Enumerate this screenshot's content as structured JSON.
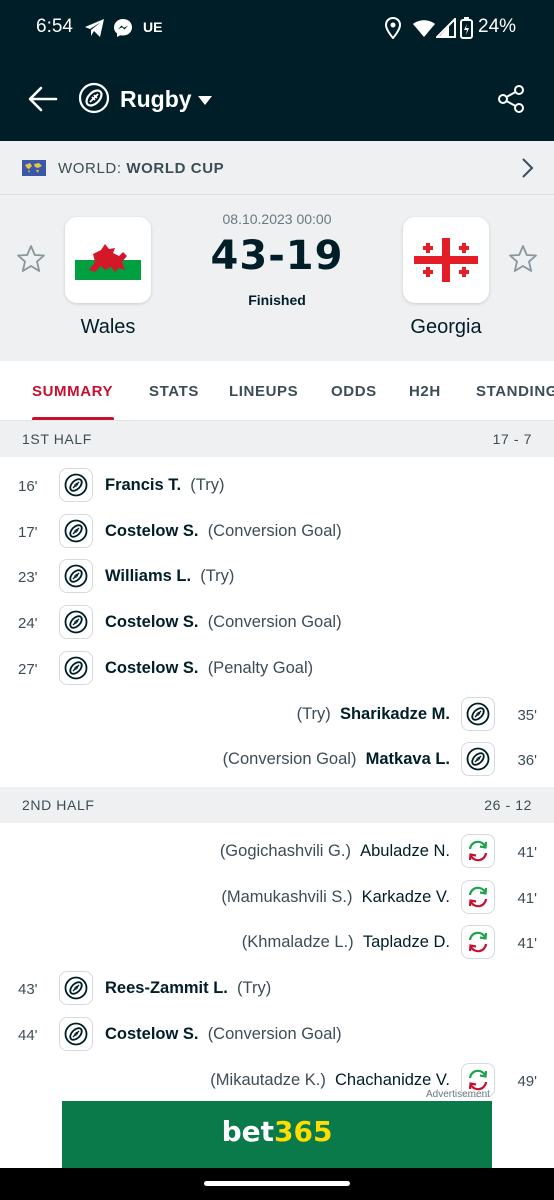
{
  "status_bar": {
    "time": "6:54",
    "carrier_badge": "UE",
    "battery": "24%"
  },
  "app_bar": {
    "sport": "Rugby",
    "icons": [
      "back-arrow-icon",
      "rugby-ball-icon",
      "dropdown-caret-icon",
      "share-icon"
    ]
  },
  "competition": {
    "region": "WORLD: ",
    "name": "WORLD CUP"
  },
  "match": {
    "date": "08.10.2023 00:00",
    "score": "43-19",
    "status": "Finished",
    "home": {
      "name": "Wales"
    },
    "away": {
      "name": "Georgia"
    }
  },
  "tabs": [
    "SUMMARY",
    "STATS",
    "LINEUPS",
    "ODDS",
    "H2H",
    "STANDINGS"
  ],
  "first_half": {
    "title": "1ST HALF",
    "score": "17 - 7",
    "events": [
      {
        "side": "home",
        "minute": "16'",
        "player": "Francis T.",
        "detail": "(Try)",
        "icon": "rugby-ball-icon"
      },
      {
        "side": "home",
        "minute": "17'",
        "player": "Costelow S.",
        "detail": "(Conversion Goal)",
        "icon": "rugby-ball-icon"
      },
      {
        "side": "home",
        "minute": "23'",
        "player": "Williams L.",
        "detail": "(Try)",
        "icon": "rugby-ball-icon"
      },
      {
        "side": "home",
        "minute": "24'",
        "player": "Costelow S.",
        "detail": "(Conversion Goal)",
        "icon": "rugby-ball-icon"
      },
      {
        "side": "home",
        "minute": "27'",
        "player": "Costelow S.",
        "detail": "(Penalty Goal)",
        "icon": "rugby-ball-icon"
      },
      {
        "side": "away",
        "minute": "35'",
        "player": "Sharikadze M.",
        "detail": "(Try)",
        "icon": "rugby-ball-icon"
      },
      {
        "side": "away",
        "minute": "36'",
        "player": "Matkava L.",
        "detail": "(Conversion Goal)",
        "icon": "rugby-ball-icon"
      }
    ]
  },
  "second_half": {
    "title": "2ND HALF",
    "score": "26 - 12",
    "events": [
      {
        "side": "away",
        "minute": "41'",
        "player": "Abuladze N.",
        "detail": "(Gogichashvili G.)",
        "icon": "substitution-icon"
      },
      {
        "side": "away",
        "minute": "41'",
        "player": "Karkadze V.",
        "detail": "(Mamukashvili S.)",
        "icon": "substitution-icon"
      },
      {
        "side": "away",
        "minute": "41'",
        "player": "Tapladze D.",
        "detail": "(Khmaladze L.)",
        "icon": "substitution-icon"
      },
      {
        "side": "home",
        "minute": "43'",
        "player": "Rees-Zammit L.",
        "detail": "(Try)",
        "icon": "rugby-ball-icon"
      },
      {
        "side": "home",
        "minute": "44'",
        "player": "Costelow S.",
        "detail": "(Conversion Goal)",
        "icon": "rugby-ball-icon"
      },
      {
        "side": "away",
        "minute": "49'",
        "player": "Chachanidze V.",
        "detail": "(Mikautadze K.)",
        "icon": "substitution-icon"
      }
    ]
  },
  "ad": {
    "label": "Advertisement",
    "brand_main": "bet",
    "brand_accent": "365"
  },
  "colors": {
    "header_bg": "#001e28",
    "accent": "#c8102e",
    "panel_bg": "#eef0f1",
    "sub_in": "#1aa34a",
    "sub_out": "#c8102e"
  }
}
